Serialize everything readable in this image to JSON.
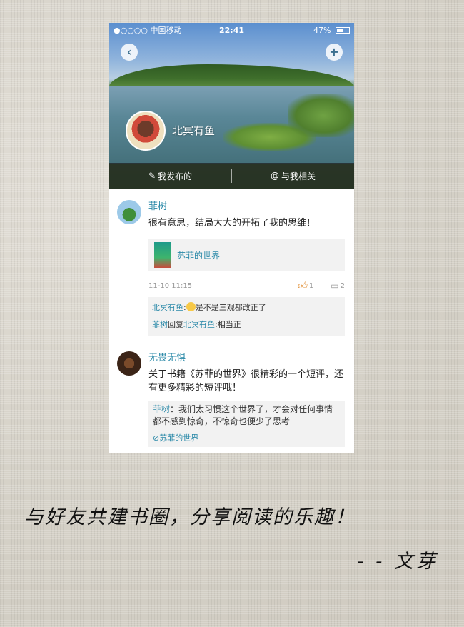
{
  "status": {
    "carrier": "●○○○○ 中国移动",
    "time": "22:41",
    "battery": "47%"
  },
  "header": {
    "back_icon": "chevron-left-icon",
    "add_icon": "plus-icon",
    "username": "北冥有鱼"
  },
  "tabs": [
    {
      "label": "我发布的",
      "icon": "edit-icon"
    },
    {
      "label": "与我相关",
      "icon": "at-icon"
    }
  ],
  "posts": [
    {
      "author": "菲树",
      "text": "很有意思，结局大大的开拓了我的思维！",
      "book_title": "苏菲的世界",
      "time": "11-10 11:15",
      "likes": "1",
      "comments_count": "2",
      "comments": [
        {
          "from": "北冥有鱼",
          "sep": ":",
          "text": "是不是三观都改正了"
        },
        {
          "from": "菲树",
          "reply_word": "回复",
          "to": "北冥有鱼",
          "sep": ":",
          "text": "相当正"
        }
      ]
    },
    {
      "author": "无畏无惧",
      "text": "关于书籍《苏菲的世界》很精彩的一个短评，还有更多精彩的短评哦！",
      "quote_author": "菲树",
      "quote_text": "：我们太习惯这个世界了，才会对任何事情都不感到惊奇，不惊奇也便少了思考",
      "ref": "苏菲的世界"
    }
  ],
  "caption": {
    "main": "与好友共建书圈，分享阅读的乐趣！",
    "sign": "- - 文芽"
  }
}
